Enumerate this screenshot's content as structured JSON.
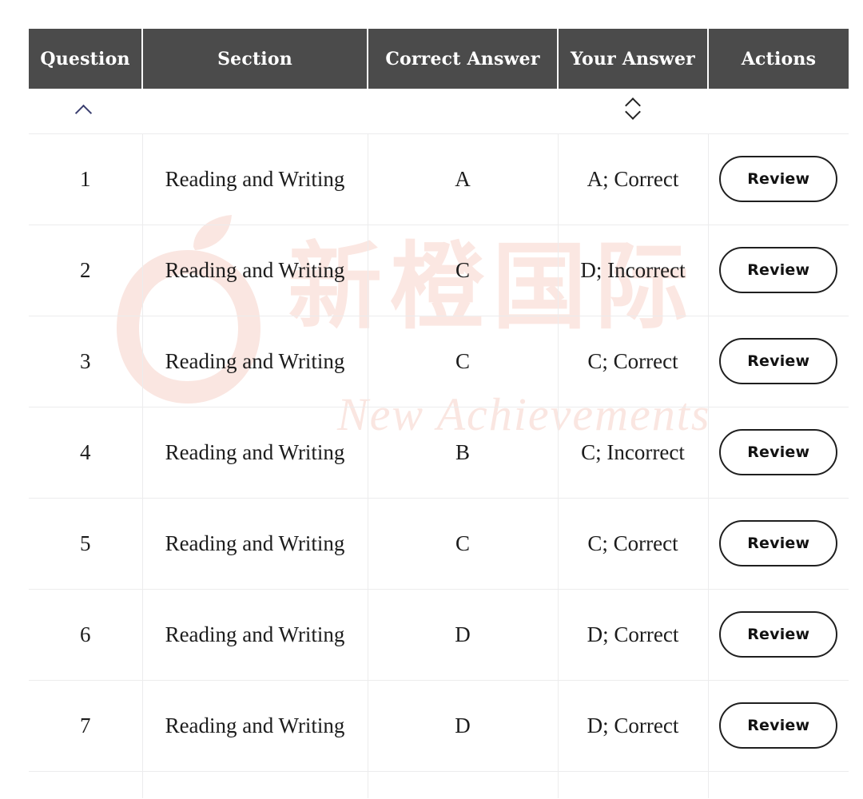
{
  "watermark": {
    "chinese_text": "新橙国际",
    "english_text": "New Achievements",
    "logo_icon": "orange-fruit-logo-icon",
    "color": "#fae6e1"
  },
  "table": {
    "columns": [
      {
        "key": "question",
        "label": "Question",
        "sort_state": "ascending",
        "sort_icon": "chevron-up-icon"
      },
      {
        "key": "section",
        "label": "Section",
        "sort_state": "none",
        "sort_icon": ""
      },
      {
        "key": "correct_answer",
        "label": "Correct Answer",
        "sort_state": "none",
        "sort_icon": ""
      },
      {
        "key": "your_answer",
        "label": "Your Answer",
        "sort_state": "unsorted",
        "sort_icon": "chevron-up-down-icon"
      },
      {
        "key": "actions",
        "label": "Actions",
        "sort_state": "none",
        "sort_icon": ""
      }
    ],
    "header_bg": "#4b4b4b",
    "header_text_color": "#ffffff",
    "correct_color": "#3e7b4f",
    "incorrect_color": "#9c2f3e",
    "row_divider_color": "#ececed",
    "action_label": "Review",
    "rows": [
      {
        "question": "1",
        "section": "Reading and Writing",
        "correct_answer": "A",
        "your_answer": "A; Correct",
        "status": "correct",
        "action": "Review"
      },
      {
        "question": "2",
        "section": "Reading and Writing",
        "correct_answer": "C",
        "your_answer": "D; Incorrect",
        "status": "incorrect",
        "action": "Review"
      },
      {
        "question": "3",
        "section": "Reading and Writing",
        "correct_answer": "C",
        "your_answer": "C; Correct",
        "status": "correct",
        "action": "Review"
      },
      {
        "question": "4",
        "section": "Reading and Writing",
        "correct_answer": "B",
        "your_answer": "C; Incorrect",
        "status": "incorrect",
        "action": "Review"
      },
      {
        "question": "5",
        "section": "Reading and Writing",
        "correct_answer": "C",
        "your_answer": "C; Correct",
        "status": "correct",
        "action": "Review"
      },
      {
        "question": "6",
        "section": "Reading and Writing",
        "correct_answer": "D",
        "your_answer": "D; Correct",
        "status": "correct",
        "action": "Review"
      },
      {
        "question": "7",
        "section": "Reading and Writing",
        "correct_answer": "D",
        "your_answer": "D; Correct",
        "status": "correct",
        "action": "Review"
      }
    ]
  }
}
